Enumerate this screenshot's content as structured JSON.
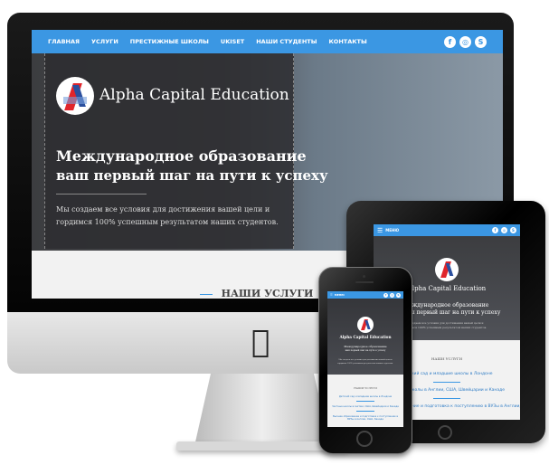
{
  "site": {
    "brand": "Alpha Capital Education",
    "nav": [
      "ГЛАВНАЯ",
      "УСЛУГИ",
      "ПРЕСТИЖНЫЕ ШКОЛЫ",
      "UKISET",
      "НАШИ СТУДЕНТЫ",
      "КОНТАКТЫ"
    ],
    "mobile_menu_label": "МЕНЮ",
    "social": [
      {
        "icon": "facebook-icon",
        "glyph": "f"
      },
      {
        "icon": "instagram-icon",
        "glyph": "◎"
      },
      {
        "icon": "skype-icon",
        "glyph": "S"
      }
    ],
    "headline_1": "Международное образование",
    "headline_2": "ваш первый шаг на пути к успеху",
    "lead_1": "Мы создаем все условия для достижения вашей цели и",
    "lead_2": "гордимся 100% успешным результатом наших студентов.",
    "services_title": "НАШИ УСЛУГИ",
    "services": [
      "Детский сад и младшие школы в Лондоне",
      "Частные школы в Англии, США, Швейцарии и Канаде",
      "Высшее образование и подготовка к поступлению в ВУЗы в Англии, США, Канаде"
    ]
  },
  "colors": {
    "accent": "#3b97e3",
    "logo_red": "#e0252b",
    "logo_blue": "#2a4f9e"
  }
}
